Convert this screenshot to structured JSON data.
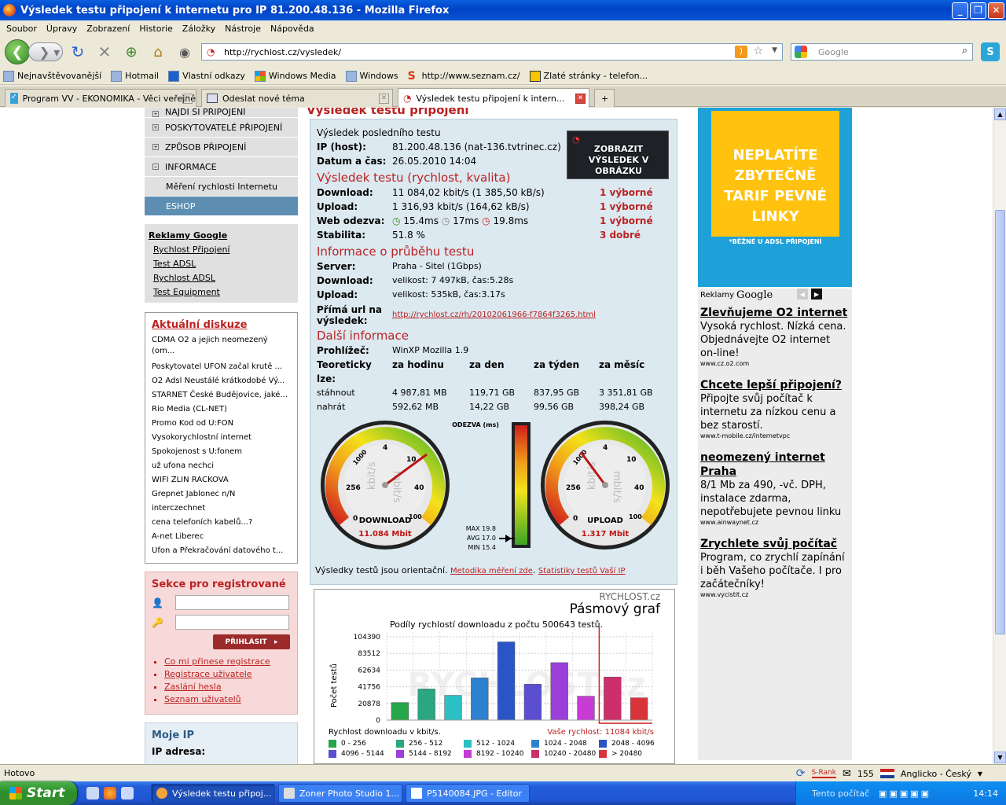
{
  "window": {
    "title": "Výsledek testu připojení k internetu pro IP 81.200.48.136 - Mozilla Firefox"
  },
  "menu": [
    "Soubor",
    "Úpravy",
    "Zobrazení",
    "Historie",
    "Záložky",
    "Nástroje",
    "Nápověda"
  ],
  "nav": {
    "url": "http://rychlost.cz/vysledek/",
    "search_placeholder": "Google"
  },
  "bookmarks": [
    "Nejnavštěvovanější",
    "Hotmail",
    "Vlastní odkazy",
    "Windows Media",
    "Windows",
    "http://www.seznam.cz/",
    "Zlaté stránky - telefon..."
  ],
  "tabs": [
    "Program VV - EKONOMIKA - Věci veřejné",
    "Odeslat nové téma",
    "Výsledek testu připojení k intern..."
  ],
  "leftmenu": {
    "items": [
      "NAJDI SI PŘIPOJENÍ",
      "POSKYTOVATELÉ PŘIPOJENÍ",
      "ZPŮSOB PŘIPOJENÍ",
      "INFORMACE"
    ],
    "sub": "Měření rychlosti Internetu",
    "shop": "ESHOP"
  },
  "ads_google": {
    "head": "Reklamy Google",
    "links": [
      "Rychlost Připojení",
      "Test ADSL",
      "Rychlost ADSL",
      "Test Equipment"
    ]
  },
  "diskuze": {
    "head": "Aktuální diskuze",
    "items": [
      "CDMA O2 a jejich neomezený (om...",
      "Poskytovatel UFON začal krutě ...",
      "O2 Adsl Neustálé krátkodobé Vý...",
      "STARNET České Budějovice, jaké...",
      "Rio Media (CL-NET)",
      "Promo Kod od U:FON",
      "Vysokorychlostní internet",
      "Spokojenost s U:fonem",
      "už ufona nechci",
      "WIFI ZLIN RACKOVA",
      "Grepnet Jablonec n/N",
      "interczechnet",
      "cena telefoních kabelů...?",
      "A-net Liberec",
      "Ufon a Překračování datového t..."
    ]
  },
  "register": {
    "head": "Sekce pro registrované",
    "button": "PŘIHLÁSIT",
    "links": [
      "Co mi přinese registrace",
      "Registrace uživatele",
      "Zaslání hesla",
      "Seznam uživatelů"
    ]
  },
  "moje_ip": {
    "head": "Moje IP",
    "label": "IP adresa:"
  },
  "result": {
    "heading": "Výsledek testu připojení",
    "last_test": "Výsledek posledního testu",
    "ip_label": "IP (host):",
    "ip_value": "81.200.48.136 (nat-136.tvtrinec.cz)",
    "date_label": "Datum a čas:",
    "date_value": "26.05.2010 14:04",
    "image_button": "ZOBRAZIT VÝSLEDEK V OBRÁZKU",
    "speed_head": "Výsledek testu (rychlost, kvalita)",
    "download_label": "Download:",
    "download_value": "11 084,02 kbit/s (1 385,50 kB/s)",
    "download_q": "1 výborné",
    "upload_label": "Upload:",
    "upload_value": "1 316,93 kbit/s (164,62 kB/s)",
    "upload_q": "1 výborné",
    "ping_label": "Web odezva:",
    "ping1": "15.4ms",
    "ping2": "17ms",
    "ping3": "19.8ms",
    "ping_q": "1 výborné",
    "stab_label": "Stabilita:",
    "stab_value": "51.8 %",
    "stab_q": "3 dobré",
    "info_head": "Informace o průběhu testu",
    "server_label": "Server:",
    "server_value": "Praha - Sitel (1Gbps)",
    "dl_info_label": "Download:",
    "dl_info_value": "velikost: 7 497kB, čas:5.28s",
    "ul_info_label": "Upload:",
    "ul_info_value": "velikost: 535kB, čas:3.17s",
    "url_label": "Přímá url na výsledek:",
    "url_value": "http://rychlost.cz/rh/20102061966-f7864f3265.html",
    "more_head": "Další informace",
    "browser_label": "Prohlížeč:",
    "browser_value": "WinXP Mozilla 1.9",
    "theory_label": "Teoreticky lze:",
    "cols": [
      "za hodinu",
      "za den",
      "za týden",
      "za měsíc"
    ],
    "rows": [
      {
        "label": "stáhnout",
        "vals": [
          "4 987,81 MB",
          "119,71 GB",
          "837,95 GB",
          "3 351,81 GB"
        ]
      },
      {
        "label": "nahrát",
        "vals": [
          "592,62 MB",
          "14,22 GB",
          "99,56 GB",
          "398,24 GB"
        ]
      }
    ],
    "note": "Výsledky testů jsou orientační.",
    "link1": "Metodika měření zde",
    "link2": "Statistiky testů Vaší IP"
  },
  "gauges": {
    "download": {
      "label": "DOWNLOAD",
      "value": "11.084 Mbit",
      "ticks": [
        "0",
        "256",
        "1000",
        "4",
        "10",
        "40",
        "100"
      ],
      "unit": "kbit/s",
      "unit2": "mbit/s"
    },
    "upload": {
      "label": "UPLOAD",
      "value": "1.317 Mbit",
      "ticks": [
        "0",
        "256",
        "1000",
        "4",
        "10",
        "40",
        "100"
      ],
      "unit": "kbit/s",
      "unit2": "mbit/s"
    },
    "ping": {
      "title": "ODEZVA (ms)",
      "max": "MAX 19.8",
      "avg": "AVG 17.0",
      "min": "MIN 15.4"
    }
  },
  "band": {
    "brand": "RYCHLOST.cz",
    "title": "Pásmový graf",
    "subtitle": "Podíly rychlostí downloadu z počtu 500643 testů.",
    "ylabel": "Počet testů",
    "xlabel": "Rychlost downloadu v kbit/s.",
    "mine": "Vaše rychlost: 11084 kbit/s",
    "watermark": "RYCHLOST.cz",
    "legend": [
      "0 - 256",
      "256 - 512",
      "512 - 1024",
      "1024 - 2048",
      "2048 - 4096",
      "4096 - 5144",
      "5144 - 8192",
      "8192 - 10240",
      "10240 - 20480",
      "> 20480"
    ],
    "colors": [
      "#27a64a",
      "#2aa781",
      "#2cc0c4",
      "#2e81cf",
      "#2b55c7",
      "#5a4fd0",
      "#9b3fd8",
      "#c63cd4",
      "#cc2f6a",
      "#d8343a"
    ]
  },
  "chart_data": {
    "type": "bar",
    "title": "Pásmový graf",
    "subtitle": "Podíly rychlostí downloadu z počtu 500643 testů.",
    "xlabel": "Rychlost downloadu v kbit/s.",
    "ylabel": "Počet testů",
    "categories": [
      "0 - 256",
      "256 - 512",
      "512 - 1024",
      "1024 - 2048",
      "2048 - 4096",
      "4096 - 5144",
      "5144 - 8192",
      "8192 - 10240",
      "10240 - 20480",
      "> 20480"
    ],
    "values": [
      22000,
      39000,
      31000,
      53000,
      98000,
      45000,
      72000,
      30000,
      54000,
      28000
    ],
    "yticks": [
      "0",
      "20878",
      "41756",
      "62634",
      "83512",
      "104390"
    ],
    "ylim": [
      0,
      104390
    ],
    "grid": true
  },
  "right_ads": {
    "banner_big": "NEPLATÍTE ZBYTEČNĚ TARIF PEVNÉ LINKY",
    "banner_small": "*BĚŽNÉ U ADSL PŘIPOJENÍ",
    "label": "Reklamy",
    "label_g": "Google",
    "items": [
      {
        "title": "Zlevňujeme O2 internet",
        "desc": "Vysoká rychlost. Nízká cena. Objednávejte O2 internet on-line!",
        "url": "www.cz.o2.com"
      },
      {
        "title": "Chcete lepší připojení?",
        "desc": "Připojte svůj počítač k internetu za nízkou cenu a bez starostí.",
        "url": "www.t-mobile.cz/internetvpc"
      },
      {
        "title": "neomezený internet Praha",
        "desc": "8/1 Mb za 490, -vč. DPH, instalace zdarma, nepotřebujete pevnou linku",
        "url": "www.ainwaynet.cz"
      },
      {
        "title": "Zrychlete svůj počítač",
        "desc": "Program, co zrychlí zapínání i běh Vašeho počítače. I pro začátečníky!",
        "url": "www.vycistit.cz"
      }
    ]
  },
  "status": {
    "text": "Hotovo",
    "srank": "S-Rank",
    "mail": "155",
    "dict": "Anglicko - Český"
  },
  "taskbar": {
    "start": "Start",
    "tasks": [
      "Výsledek testu připoj...",
      "Zoner Photo Studio 1...",
      "P5140084.JPG - Editor"
    ],
    "tray_text": "Tento počítač",
    "time": "14:14"
  }
}
